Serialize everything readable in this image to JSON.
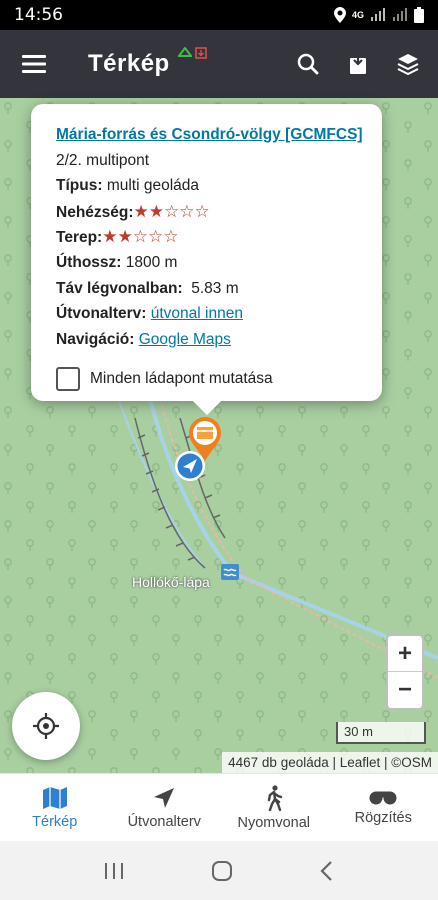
{
  "status": {
    "time": "14:56",
    "network": "4G"
  },
  "appbar": {
    "title": "Térkép"
  },
  "popup": {
    "title_link": "Mária-forrás és Csondró-völgy [GCMFCS]",
    "subtitle": "2/2. multipont",
    "type_label": "Típus:",
    "type_value": "multi geoláda",
    "difficulty_label": "Nehézség:",
    "difficulty": {
      "rating": 2,
      "max": 5
    },
    "terrain_label": "Terep:",
    "terrain": {
      "rating": 2,
      "max": 5
    },
    "length_label": "Úthossz:",
    "length_value": "1800 m",
    "distance_label": "Táv légvonalban:",
    "distance_value": "5.83 m",
    "route_label": "Útvonalterv:",
    "route_link": "útvonal innen",
    "nav_label": "Navigáció:",
    "nav_link": "Google Maps",
    "checkbox_label": "Minden ládapont mutatása"
  },
  "map": {
    "place_label": "Hollókő-lápa",
    "scale": "30 m",
    "attribution": "4467 db geoláda | Leaflet | ©OSM",
    "zoom_in": "+",
    "zoom_out": "−"
  },
  "tabs": [
    {
      "label": "Térkép",
      "icon": "map-icon",
      "active": true
    },
    {
      "label": "Útvonalterv",
      "icon": "navigation-arrow-icon",
      "active": false
    },
    {
      "label": "Nyomvonal",
      "icon": "walking-icon",
      "active": false
    },
    {
      "label": "Rögzítés",
      "icon": "record-icon",
      "active": false
    }
  ],
  "colors": {
    "accent": "#2f7fd0",
    "appbar": "#34353c",
    "map_bg": "#a9cfa1",
    "link": "#0078a8",
    "star": "#c0392b"
  }
}
